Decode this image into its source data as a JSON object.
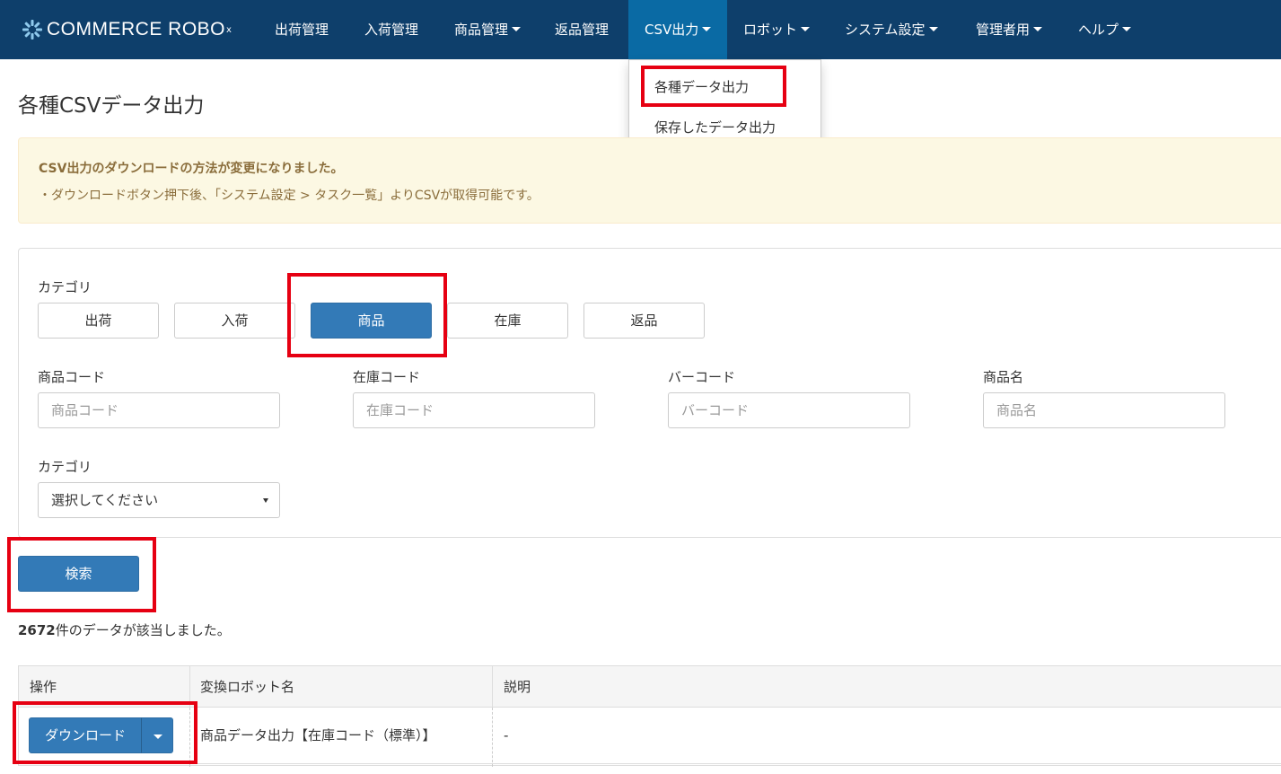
{
  "brand": {
    "name": "COMMERCE ROBO",
    "mark": "x"
  },
  "nav": {
    "items": [
      {
        "label": "出荷管理",
        "dropdown": false
      },
      {
        "label": "入荷管理",
        "dropdown": false
      },
      {
        "label": "商品管理",
        "dropdown": true
      },
      {
        "label": "返品管理",
        "dropdown": false
      },
      {
        "label": "CSV出力",
        "dropdown": true,
        "active": true
      },
      {
        "label": "ロボット",
        "dropdown": true
      },
      {
        "label": "システム設定",
        "dropdown": true
      },
      {
        "label": "管理者用",
        "dropdown": true
      },
      {
        "label": "ヘルプ",
        "dropdown": true
      }
    ],
    "csv_dropdown": [
      "各種データ出力",
      "保存したデータ出力"
    ]
  },
  "page": {
    "title": "各種CSVデータ出力"
  },
  "alert": {
    "heading": "CSV出力のダウンロードの方法が変更になりました。",
    "body": "・ダウンロードボタン押下後、「システム設定 > タスク一覧」よりCSVが取得可能です。"
  },
  "filters": {
    "category_label": "カテゴリ",
    "categories": [
      "出荷",
      "入荷",
      "商品",
      "在庫",
      "返品"
    ],
    "selected_category": "商品",
    "fields": [
      {
        "label": "商品コード",
        "placeholder": "商品コード",
        "value": ""
      },
      {
        "label": "在庫コード",
        "placeholder": "在庫コード",
        "value": ""
      },
      {
        "label": "バーコード",
        "placeholder": "バーコード",
        "value": ""
      },
      {
        "label": "商品名",
        "placeholder": "商品名",
        "value": ""
      }
    ],
    "sub_category_label": "カテゴリ",
    "sub_category_value": "選択してください",
    "search_button": "検索"
  },
  "results": {
    "count": "2672",
    "suffix": "件のデータが該当しました。"
  },
  "table": {
    "headers": [
      "操作",
      "変換ロボット名",
      "説明"
    ],
    "rows": [
      {
        "action": "ダウンロード",
        "robot_name": "商品データ出力【在庫コード（標準）】",
        "description": "-"
      }
    ]
  },
  "colors": {
    "navbar": "#0e3f6b",
    "nav_active": "#0a6aa4",
    "primary": "#337ab7",
    "highlight": "#e60012",
    "alert_bg": "#fcf8e3",
    "alert_text": "#8a6d3b"
  }
}
